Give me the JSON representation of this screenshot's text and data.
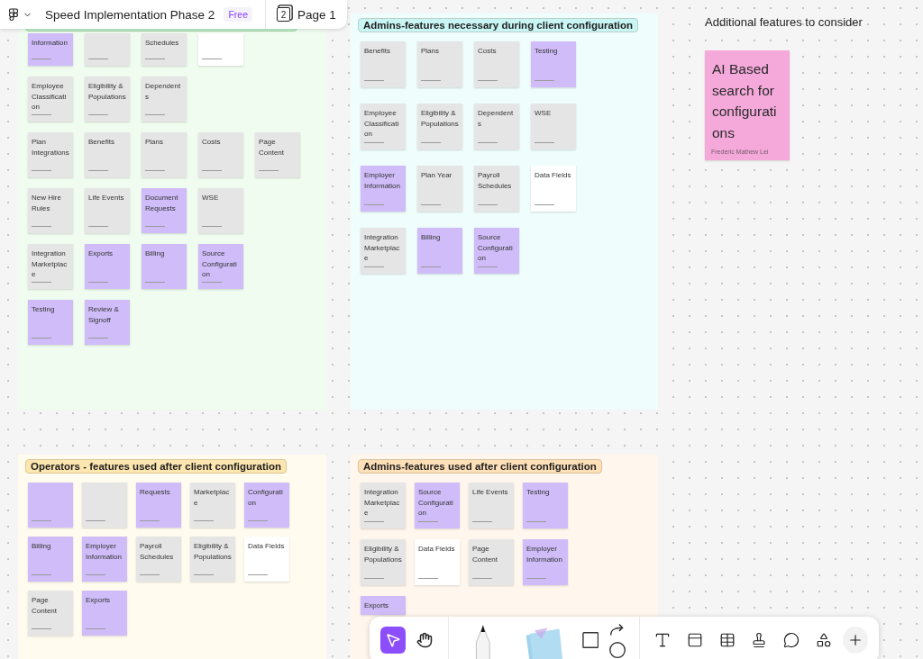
{
  "header": {
    "title": "Speed Implementation Phase 2",
    "plan": "Free",
    "page_count": "2",
    "page": "Page 1"
  },
  "sections": {
    "upper_left": {
      "color": "#effcef",
      "rows": [
        [
          {
            "text": "Information",
            "color": "#cfbcf8"
          },
          {
            "color": "#e5e5e5"
          },
          {
            "text": "Schedules",
            "color": "#e5e5e5"
          },
          {
            "color": "#ffffff"
          }
        ],
        [
          {
            "text": "Employee Classification",
            "color": "#e5e5e5"
          },
          {
            "text": "Eligibility & Populations",
            "color": "#e5e5e5"
          },
          {
            "text": "Dependents",
            "color": "#e5e5e5"
          }
        ],
        [
          {
            "text": "Plan Integrations",
            "color": "#e5e5e5"
          },
          {
            "text": "Benefits",
            "color": "#e5e5e5"
          },
          {
            "text": "Plans",
            "color": "#e5e5e5"
          },
          {
            "text": "Costs",
            "color": "#e5e5e5"
          },
          {
            "text": "Page Content",
            "color": "#e5e5e5"
          }
        ],
        [
          {
            "text": "New Hire Rules",
            "color": "#e5e5e5"
          },
          {
            "text": "Life Events",
            "color": "#e5e5e5"
          },
          {
            "text": "Document Requests",
            "color": "#cfbcf8"
          },
          {
            "text": "WSE",
            "color": "#e5e5e5"
          }
        ],
        [
          {
            "text": "Integration Marketplace",
            "color": "#e5e5e5"
          },
          {
            "text": "Exports",
            "color": "#cfbcf8"
          },
          {
            "text": "Billing",
            "color": "#cfbcf8"
          },
          {
            "text": "Source Configuration",
            "color": "#cfbcf8"
          }
        ],
        [
          {
            "text": "Testing",
            "color": "#cfbcf8"
          },
          {
            "text": "Review & Signoff",
            "color": "#cfbcf8"
          }
        ]
      ]
    },
    "upper_right": {
      "title": "Admins-features necessary during client configuration",
      "color": "#effdfd",
      "rows": [
        [
          {
            "text": "Benefits",
            "color": "#e5e5e5"
          },
          {
            "text": "Plans",
            "color": "#e5e5e5"
          },
          {
            "text": "Costs",
            "color": "#e5e5e5"
          },
          {
            "text": "Testing",
            "color": "#cfbcf8"
          }
        ],
        [
          {
            "text": "Employee Classification",
            "color": "#e5e5e5"
          },
          {
            "text": "Eligibility & Populations",
            "color": "#e5e5e5"
          },
          {
            "text": "Dependents",
            "color": "#e5e5e5"
          },
          {
            "text": "WSE",
            "color": "#e5e5e5"
          }
        ],
        [
          {
            "text": "Employer Information",
            "color": "#cfbcf8"
          },
          {
            "text": "Plan Year",
            "color": "#e5e5e5"
          },
          {
            "text": "Payroll Schedules",
            "color": "#e5e5e5"
          },
          {
            "text": "Data Fields",
            "color": "#ffffff"
          }
        ],
        [
          {
            "text": "Integration Marketplace",
            "color": "#e5e5e5"
          },
          {
            "text": "Billing",
            "color": "#cfbcf8"
          },
          {
            "text": "Source Configuration",
            "color": "#cfbcf8"
          }
        ]
      ]
    },
    "lower_left": {
      "title": "Operators - features used after client configuration",
      "color": "#fffbee",
      "rows": [
        [
          {
            "color": "#cfbcf8"
          },
          {
            "color": "#e5e5e5"
          },
          {
            "text": "Requests",
            "color": "#cfbcf8"
          },
          {
            "text": "Marketplace",
            "color": "#e5e5e5"
          },
          {
            "text": "Configuration",
            "color": "#cfbcf8"
          }
        ],
        [
          {
            "text": "Billing",
            "color": "#cfbcf8"
          },
          {
            "text": "Employer Information",
            "color": "#cfbcf8"
          },
          {
            "text": "Payroll Schedules",
            "color": "#e5e5e5"
          },
          {
            "text": "Eligibility & Populations",
            "color": "#e5e5e5"
          },
          {
            "text": "Data Fields",
            "color": "#ffffff"
          }
        ],
        [
          {
            "text": "Page Content",
            "color": "#e5e5e5"
          },
          {
            "text": "Exports",
            "color": "#cfbcf8"
          }
        ]
      ]
    },
    "lower_right": {
      "title": "Admins-features used after client configuration",
      "color": "#fff6ee",
      "rows": [
        [
          {
            "text": "Integration Marketplace",
            "color": "#e5e5e5"
          },
          {
            "text": "Source Configuration",
            "color": "#cfbcf8"
          },
          {
            "text": "Life Events",
            "color": "#e5e5e5"
          },
          {
            "text": "Testing",
            "color": "#cfbcf8"
          }
        ],
        [
          {
            "text": "Eligibility & Populations",
            "color": "#e5e5e5"
          },
          {
            "text": "Data Fields",
            "color": "#ffffff"
          },
          {
            "text": "Page Content",
            "color": "#e5e5e5"
          },
          {
            "text": "Employer Information",
            "color": "#cfbcf8"
          }
        ],
        [
          {
            "text": "Exports",
            "color": "#cfbcf8"
          }
        ]
      ]
    }
  },
  "extra": {
    "heading": "Additional features to consider",
    "sticky": {
      "text": "AI Based search for configurations",
      "author": "Frederic Mathew Lei",
      "color": "#f4a9da"
    }
  },
  "tools": [
    {
      "selected": true
    },
    {
      "selected": false
    }
  ]
}
